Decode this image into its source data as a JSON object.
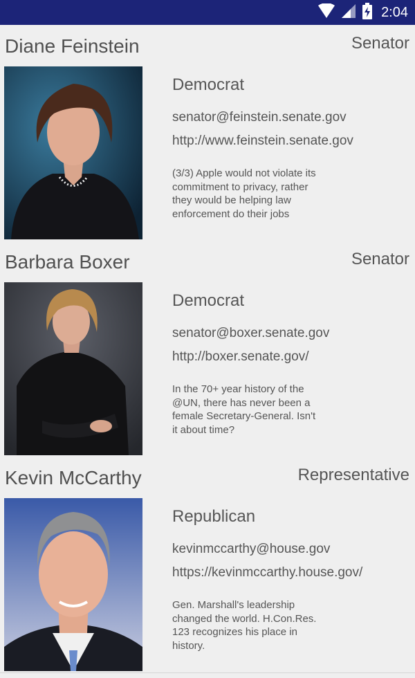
{
  "status_bar": {
    "time": "2:04",
    "icons": [
      "wifi-icon",
      "signal-icon",
      "battery-charging-icon"
    ]
  },
  "officials": [
    {
      "name": "Diane Feinstein",
      "title": "Senator",
      "party": "Democrat",
      "email": "senator@feinstein.senate.gov",
      "url": "http://www.feinstein.senate.gov",
      "tweet": "(3/3) Apple would not violate its commitment to privacy, rather they would be helping law enforcement do their jobs"
    },
    {
      "name": "Barbara Boxer",
      "title": "Senator",
      "party": "Democrat",
      "email": "senator@boxer.senate.gov",
      "url": "http://boxer.senate.gov/",
      "tweet": "In the 70+ year history of the @UN, there has never been a female Secretary-General. Isn't it about time?"
    },
    {
      "name": "Kevin McCarthy",
      "title": "Representative",
      "party": "Republican",
      "email": "kevinmccarthy@house.gov",
      "url": "https://kevinmccarthy.house.gov/",
      "tweet": "Gen. Marshall's leadership changed the world. H.Con.Res. 123 recognizes his place in history."
    }
  ],
  "colors": {
    "status_bar": "#1c2478",
    "background": "#efefef",
    "text": "#555555",
    "divider": "#d6d6d6"
  }
}
